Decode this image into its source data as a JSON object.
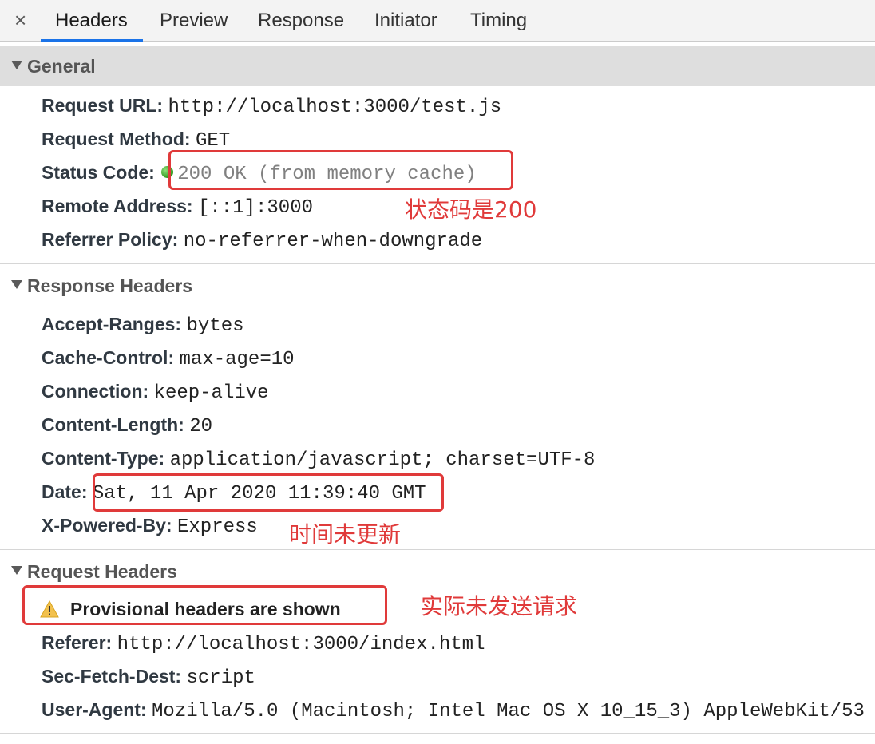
{
  "tabs": {
    "close": "×",
    "items": [
      "Headers",
      "Preview",
      "Response",
      "Initiator",
      "Timing"
    ],
    "active": "Headers"
  },
  "general": {
    "title": "General",
    "request_url": {
      "key": "Request URL:",
      "value": "http://localhost:3000/test.js"
    },
    "request_method": {
      "key": "Request Method:",
      "value": "GET"
    },
    "status_code": {
      "key": "Status Code:",
      "value": "200 OK (from memory cache)"
    },
    "remote_address": {
      "key": "Remote Address:",
      "value": "[::1]:3000"
    },
    "referrer_policy": {
      "key": "Referrer Policy:",
      "value": "no-referrer-when-downgrade"
    }
  },
  "response_headers": {
    "title": "Response Headers",
    "accept_ranges": {
      "key": "Accept-Ranges:",
      "value": "bytes"
    },
    "cache_control": {
      "key": "Cache-Control:",
      "value": "max-age=10"
    },
    "connection": {
      "key": "Connection:",
      "value": "keep-alive"
    },
    "content_length": {
      "key": "Content-Length:",
      "value": "20"
    },
    "content_type": {
      "key": "Content-Type:",
      "value": "application/javascript; charset=UTF-8"
    },
    "date": {
      "key": "Date:",
      "value": "Sat, 11 Apr 2020 11:39:40 GMT"
    },
    "x_powered_by": {
      "key": "X-Powered-By:",
      "value": "Express"
    }
  },
  "request_headers": {
    "title": "Request Headers",
    "provisional_warning": "Provisional headers are shown",
    "referer": {
      "key": "Referer:",
      "value": "http://localhost:3000/index.html"
    },
    "sec_fetch_dest": {
      "key": "Sec-Fetch-Dest:",
      "value": "script"
    },
    "user_agent": {
      "key": "User-Agent:",
      "value": "Mozilla/5.0 (Macintosh; Intel Mac OS X 10_15_3) AppleWebKit/53"
    }
  },
  "annotations": {
    "status_note": "状态码是200",
    "date_note": "时间未更新",
    "request_note": "实际未发送请求"
  },
  "colors": {
    "accent": "#1a73e8",
    "annotation_red": "#e03a3a",
    "status_green": "#2e9a1e"
  }
}
